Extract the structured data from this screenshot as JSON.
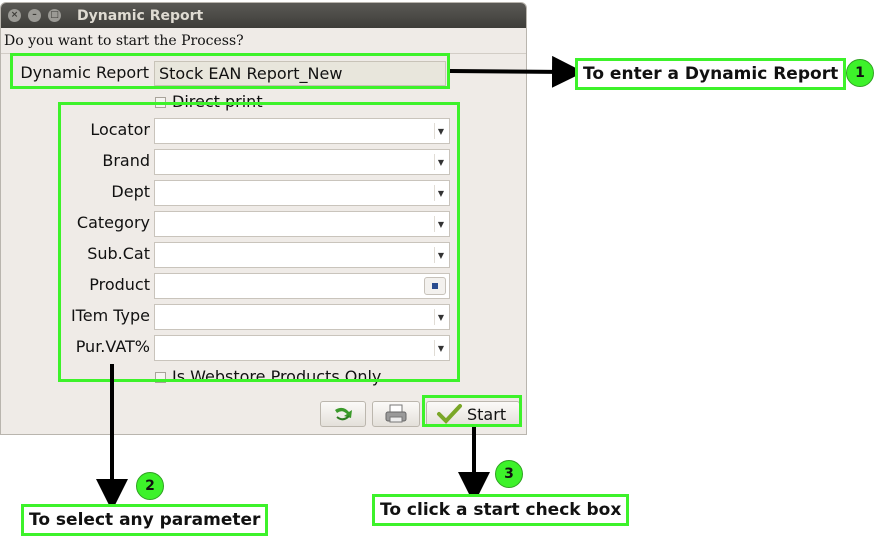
{
  "window": {
    "title": "Dynamic Report",
    "question": "Do you want to start the Process?"
  },
  "report": {
    "label": "Dynamic Report",
    "value": "Stock EAN Report_New",
    "direct_print_label": "Direct print"
  },
  "parameters": [
    {
      "label": "Locator",
      "value": "",
      "type": "combo"
    },
    {
      "label": "Brand",
      "value": "",
      "type": "combo"
    },
    {
      "label": "Dept",
      "value": "",
      "type": "combo"
    },
    {
      "label": "Category",
      "value": "",
      "type": "combo"
    },
    {
      "label": "Sub.Cat",
      "value": "",
      "type": "combo"
    },
    {
      "label": "Product",
      "value": "",
      "type": "lookup"
    },
    {
      "label": "ITem Type",
      "value": "",
      "type": "combo"
    },
    {
      "label": "Pur.VAT%",
      "value": "",
      "type": "combo"
    }
  ],
  "webstore_label": "Is Webstore Products Only",
  "buttons": {
    "start_label": "Start"
  },
  "annotations": {
    "callout1": "To enter a Dynamic Report",
    "callout2": "To select any parameter",
    "callout3": "To click a start check box",
    "num1": "1",
    "num2": "2",
    "num3": "3"
  },
  "colors": {
    "highlight": "#3df22a",
    "dialog_bg": "#efebe7",
    "titlebar": "#3e3d39"
  }
}
